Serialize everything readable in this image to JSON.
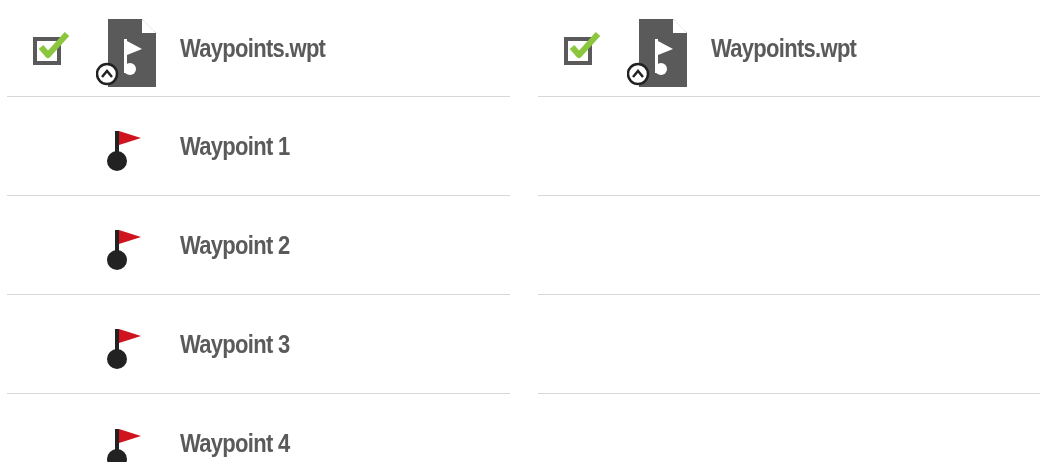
{
  "panels": [
    {
      "file": {
        "name": "Waypoints.wpt",
        "checked": true
      },
      "waypoints": [
        {
          "name": "Waypoint 1"
        },
        {
          "name": "Waypoint 2"
        },
        {
          "name": "Waypoint 3"
        },
        {
          "name": "Waypoint 4"
        }
      ]
    },
    {
      "file": {
        "name": "Waypoints.wpt",
        "checked": true
      }
    }
  ]
}
